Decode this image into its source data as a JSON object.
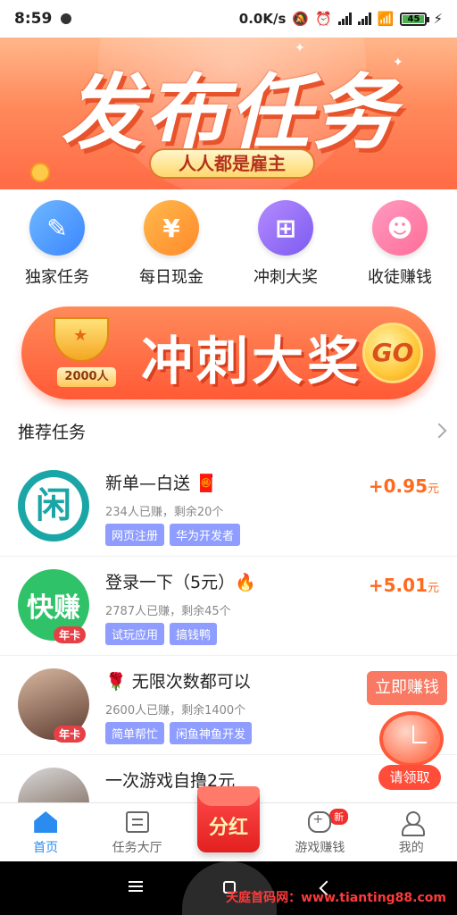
{
  "status_bar": {
    "time": "8:59",
    "network_speed": "0.0K/s",
    "battery": "45"
  },
  "banner": {
    "headline": "发布任务",
    "subtitle": "人人都是雇主"
  },
  "quick_actions": [
    {
      "label": "独家任务",
      "icon": "edit-document-icon",
      "glyph": "✎"
    },
    {
      "label": "每日现金",
      "icon": "yen-icon",
      "glyph": "¥"
    },
    {
      "label": "冲刺大奖",
      "icon": "hierarchy-icon",
      "glyph": "⊞"
    },
    {
      "label": "收徒赚钱",
      "icon": "users-icon",
      "glyph": "☻"
    }
  ],
  "promo": {
    "title": "冲刺大奖",
    "plaque": "2000人",
    "go_label": "GO"
  },
  "section": {
    "title": "推荐任务"
  },
  "tasks": [
    {
      "name": "新单—白送 🧧",
      "meta": "234人已赚，剩余20个",
      "tags": [
        "网页注册",
        "华为开发者"
      ],
      "reward_value": "+0.95",
      "reward_unit": "元",
      "thumb_text": "闲",
      "badge": ""
    },
    {
      "name": "登录一下（5元）🔥",
      "meta": "2787人已赚，剩余45个",
      "tags": [
        "试玩应用",
        "搞钱鸭"
      ],
      "reward_value": "+5.01",
      "reward_unit": "元",
      "thumb_text": "快赚",
      "badge": "年卡"
    },
    {
      "name": "🌹 无限次数都可以",
      "meta": "2600人已赚，剩余1400个",
      "tags": [
        "简单帮忙",
        "闲鱼神鱼开发"
      ],
      "reward_value": "",
      "reward_unit": "",
      "thumb_text": "",
      "badge": "年卡"
    },
    {
      "name": "一次游戏自撸2元",
      "meta": "",
      "tags": [],
      "reward_value": "",
      "reward_unit": "",
      "thumb_text": "",
      "badge": ""
    }
  ],
  "floating": {
    "earn_now": "立即赚钱",
    "claim": "请领取"
  },
  "bottom_nav": {
    "items": [
      {
        "label": "首页",
        "icon": "home-icon"
      },
      {
        "label": "任务大厅",
        "icon": "document-icon"
      },
      {
        "label": "分红",
        "icon": "red-packet-icon"
      },
      {
        "label": "游戏赚钱",
        "icon": "gamepad-icon"
      },
      {
        "label": "我的",
        "icon": "user-icon"
      }
    ],
    "new_badge": "新"
  },
  "watermark": "天庭首码网：www.tianting88.com",
  "colors": {
    "accent_orange": "#ff6a1f",
    "tag_purple": "#8e9dff",
    "nav_active": "#2b8cf0"
  }
}
